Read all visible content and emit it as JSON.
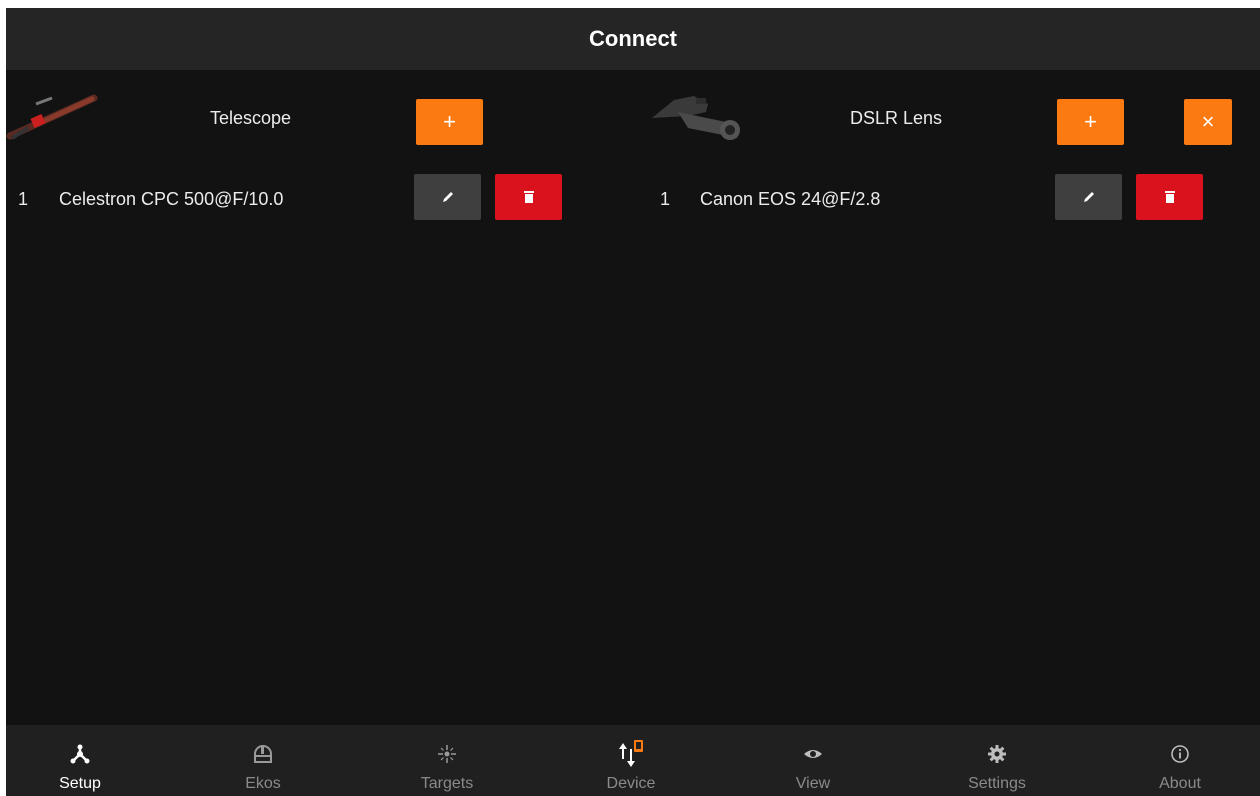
{
  "header": {
    "title": "Connect"
  },
  "telescope_panel": {
    "title": "Telescope",
    "add_label": "+",
    "items": [
      {
        "index": "1",
        "name": "Celestron CPC 500@F/10.0"
      }
    ]
  },
  "lens_panel": {
    "title": "DSLR Lens",
    "add_label": "+",
    "close_label": "×",
    "items": [
      {
        "index": "1",
        "name": "Canon EOS 24@F/2.8"
      }
    ]
  },
  "nav": {
    "active": "Setup",
    "items": [
      {
        "label": "Setup",
        "icon": "setup-icon"
      },
      {
        "label": "Ekos",
        "icon": "observatory-dome-icon"
      },
      {
        "label": "Targets",
        "icon": "target-star-icon"
      },
      {
        "label": "Device",
        "icon": "device-transfer-icon"
      },
      {
        "label": "View",
        "icon": "eye-icon"
      },
      {
        "label": "Settings",
        "icon": "gear-icon"
      },
      {
        "label": "About",
        "icon": "info-icon"
      }
    ]
  },
  "colors": {
    "background": "#121212",
    "header": "#252525",
    "accent_orange": "#fb7a12",
    "danger_red": "#d9121e",
    "edit_grey": "#3f3f3f"
  }
}
